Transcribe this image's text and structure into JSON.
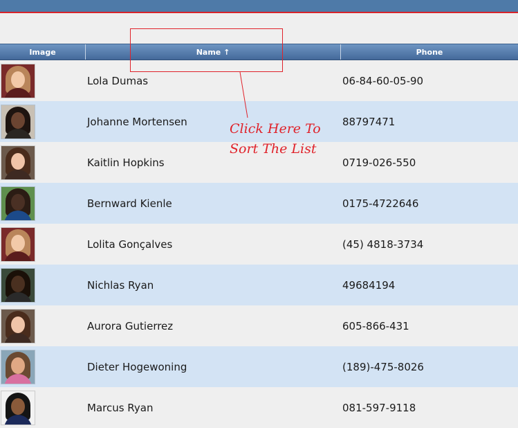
{
  "header": {
    "columns": [
      {
        "label": "Image"
      },
      {
        "label": "Name ↑"
      },
      {
        "label": "Phone"
      }
    ]
  },
  "annotation": {
    "text": "Click Here To\nSort The List"
  },
  "rows": [
    {
      "name": "Lola Dumas",
      "phone": "06-84-60-05-90",
      "avatar": {
        "bg": "#7a2a2a",
        "hair": "#b9855a",
        "face": "#f2c9a8",
        "body": "#5a1c1c"
      }
    },
    {
      "name": "Johanne Mortensen",
      "phone": "88797471",
      "avatar": {
        "bg": "#c8c0b4",
        "hair": "#1e1410",
        "face": "#6b4431",
        "body": "#2a2622"
      }
    },
    {
      "name": "Kaitlin Hopkins",
      "phone": "0719-026-550",
      "avatar": {
        "bg": "#6c5a4c",
        "hair": "#4a2c1c",
        "face": "#f0c4a8",
        "body": "#3e2a22"
      }
    },
    {
      "name": "Bernward Kienle",
      "phone": "0175-4722646",
      "avatar": {
        "bg": "#5f8f4e",
        "hair": "#2b1c14",
        "face": "#4a3024",
        "body": "#1c4a8a"
      }
    },
    {
      "name": "Lolita Gonçalves",
      "phone": "(45) 4818-3734",
      "avatar": {
        "bg": "#7a2a2a",
        "hair": "#b9855a",
        "face": "#f2c9a8",
        "body": "#5a1c1c"
      }
    },
    {
      "name": "Nichlas Ryan",
      "phone": "49684194",
      "avatar": {
        "bg": "#3a4a3a",
        "hair": "#1a1008",
        "face": "#4a3020",
        "body": "#2a2a2a"
      }
    },
    {
      "name": "Aurora Gutierrez",
      "phone": "605-866-431",
      "avatar": {
        "bg": "#6c5a4c",
        "hair": "#4a2c1c",
        "face": "#f0c4a8",
        "body": "#3e2a22"
      }
    },
    {
      "name": "Dieter Hogewoning",
      "phone": "(189)-475-8026",
      "avatar": {
        "bg": "#8aa6b8",
        "hair": "#6a4a32",
        "face": "#e0a884",
        "body": "#d870a0"
      }
    },
    {
      "name": "Marcus Ryan",
      "phone": "081-597-9118",
      "avatar": {
        "bg": "#f2f2f2",
        "hair": "#141414",
        "face": "#8a5a3a",
        "body": "#1c2a5a"
      }
    }
  ]
}
